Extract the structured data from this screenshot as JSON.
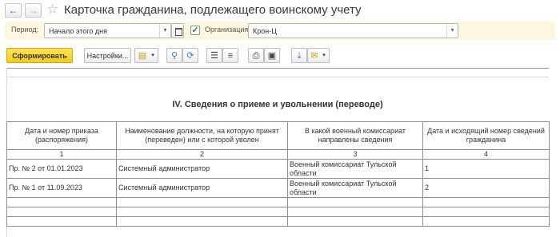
{
  "window": {
    "title": "Карточка гражданина, подлежащего воинскому учету",
    "back_icon": "←",
    "forward_icon": "→",
    "favorite_icon": "☆"
  },
  "filters": {
    "period_label": "Период:",
    "period_value": "Начало этого дня",
    "organization_checked": true,
    "organization_label": "Организация:",
    "organization_value": "Крон-Ц"
  },
  "toolbar": {
    "generate_label": "Сформировать",
    "settings_label": "Настройки..."
  },
  "report": {
    "section_title": "IV. Сведения о приеме и увольнении (переводе)",
    "columns": [
      "Дата и номер приказа (распоряжения)",
      "Наименование должности, на которую принят (переведен) или с которой уволен",
      "В какой военный комиссариат направлены сведения",
      "Дата и исходящий номер сведений гражданина"
    ],
    "column_numbers": [
      "1",
      "2",
      "3",
      "4"
    ],
    "rows": [
      {
        "order": "Пр. № 2 от 01.01.2023",
        "position": "Системный администратор",
        "commissariat": "Военный комиссариат Тульской области",
        "number": "1"
      },
      {
        "order": "Пр. № 1 от 11.09.2023",
        "position": "Системный администратор",
        "commissariat": "Военный комиссариат Тульской области",
        "number": "2"
      }
    ]
  },
  "colors": {
    "accent": "#f6cb17",
    "filter_background": "#fdf7e0"
  }
}
